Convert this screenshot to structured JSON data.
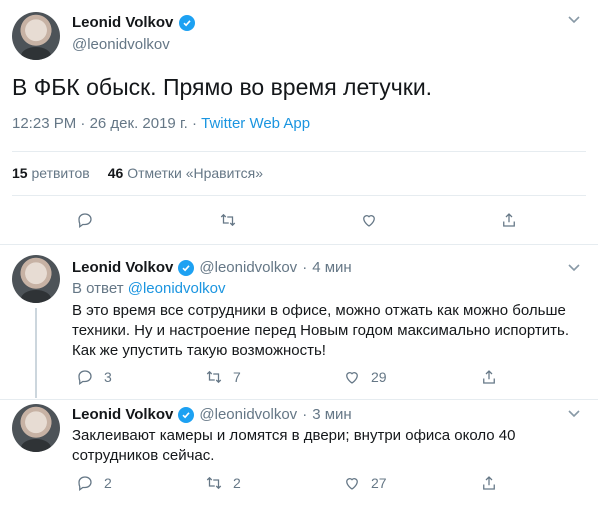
{
  "main_tweet": {
    "author_name": "Leonid Volkov",
    "handle": "@leonidvolkov",
    "text": "В ФБК обыск. Прямо во время летучки.",
    "time": "12:23 PM",
    "date": "26 дек. 2019 г.",
    "separator": "·",
    "source": "Twitter Web App",
    "retweets_count": "15",
    "retweets_label": "ретвитов",
    "likes_count": "46",
    "likes_label": "Отметки «Нравится»"
  },
  "replies": [
    {
      "author_name": "Leonid Volkov",
      "handle": "@leonidvolkov",
      "time": "4 мин",
      "reply_prefix": "В ответ",
      "reply_to": "@leonidvolkov",
      "text": "В это время все сотрудники в офисе, можно отжать как можно больше техники. Ну и настроение перед Новым годом максимально испортить. Как же упустить такую возможность!",
      "reply_count": "3",
      "retweet_count": "7",
      "like_count": "29"
    },
    {
      "author_name": "Leonid Volkov",
      "handle": "@leonidvolkov",
      "time": "3 мин",
      "text": "Заклеивают камеры и ломятся в двери; внутри офиса около 40 сотрудников сейчас.",
      "reply_count": "2",
      "retweet_count": "2",
      "like_count": "27"
    }
  ],
  "icons": [
    "reply-icon",
    "retweet-icon",
    "like-icon",
    "share-icon",
    "verified-icon",
    "chevron-down-icon"
  ],
  "colors": {
    "accent": "#1da1f2",
    "link": "#1b95e0",
    "muted": "#657786",
    "border": "#e6ecf0"
  }
}
